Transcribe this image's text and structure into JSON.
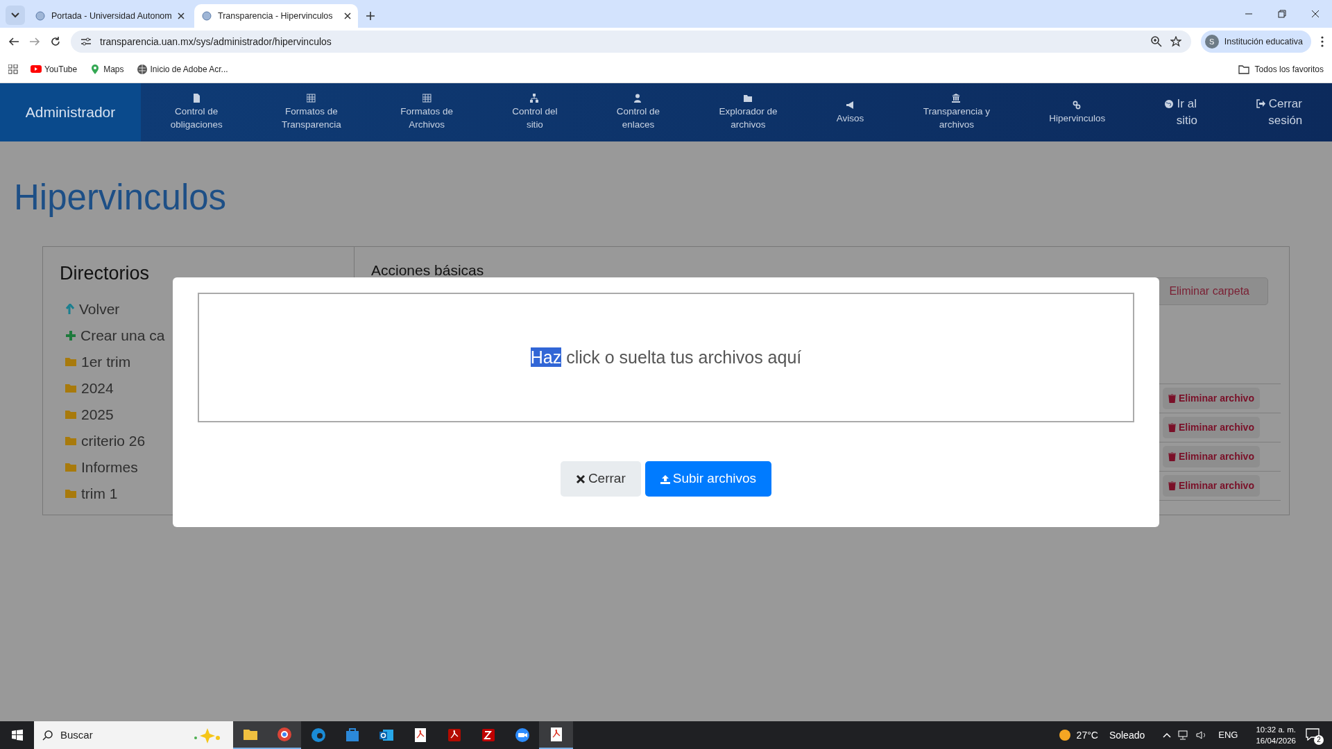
{
  "browser": {
    "tabs": [
      {
        "title": "Portada - Universidad Autonom",
        "selected": false
      },
      {
        "title": "Transparencia - Hipervinculos",
        "selected": true
      }
    ],
    "address": "transparencia.uan.mx/sys/administrador/hipervinculos",
    "profile": {
      "initial": "S",
      "name": "Institución educativa"
    },
    "bookmarks": [
      {
        "label": "YouTube"
      },
      {
        "label": "Maps"
      },
      {
        "label": "Inicio de Adobe Acr..."
      }
    ],
    "all_bookmarks": "Todos los favoritos"
  },
  "navbar": {
    "brand": "Administrador",
    "items": [
      {
        "kind": "stacked",
        "lines": [
          "Control de",
          "obligaciones"
        ]
      },
      {
        "kind": "stacked",
        "lines": [
          "Formatos de",
          "Transparencia"
        ]
      },
      {
        "kind": "stacked",
        "lines": [
          "Formatos de",
          "Archivos"
        ]
      },
      {
        "kind": "stacked",
        "lines": [
          "Control del",
          "sitio"
        ]
      },
      {
        "kind": "stacked",
        "lines": [
          "Control de",
          "enlaces"
        ]
      },
      {
        "kind": "stacked",
        "lines": [
          "Explorador de",
          "archivos"
        ]
      },
      {
        "kind": "stacked",
        "lines": [
          "Avisos"
        ]
      },
      {
        "kind": "stacked",
        "lines": [
          "Transparencia y",
          "archivos"
        ]
      },
      {
        "kind": "stacked",
        "lines": [
          "Hipervinculos"
        ]
      },
      {
        "kind": "inline",
        "lines": [
          "Ir al",
          "sitio"
        ]
      },
      {
        "kind": "inline",
        "lines": [
          "Cerrar",
          "sesión"
        ]
      }
    ]
  },
  "page": {
    "title": "Hipervinculos",
    "directories": {
      "title": "Directorios",
      "items": [
        {
          "kind": "up",
          "label": "Volver"
        },
        {
          "kind": "create",
          "label": "Crear una ca"
        },
        {
          "kind": "folder",
          "label": "1er trim"
        },
        {
          "kind": "folder",
          "label": "2024"
        },
        {
          "kind": "folder",
          "label": "2025"
        },
        {
          "kind": "folder",
          "label": "criterio 26"
        },
        {
          "kind": "folder",
          "label": "Informes"
        },
        {
          "kind": "folder",
          "label": "trim 1"
        }
      ]
    },
    "actions": {
      "title": "Acciones básicas",
      "delete_folder": "Eliminar carpeta",
      "files": [
        {
          "delete": "Eliminar archivo"
        },
        {
          "delete": "Eliminar archivo"
        },
        {
          "delete": "Eliminar archivo"
        },
        {
          "delete": "Eliminar archivo"
        }
      ]
    }
  },
  "modal": {
    "dropzone": {
      "parts": [
        {
          "text": "Haz",
          "selected": true
        },
        {
          "text": " click o suelta tus archivos aquí",
          "selected": false
        }
      ]
    },
    "buttons": [
      {
        "kind": "close",
        "label": "Cerrar"
      },
      {
        "kind": "upload",
        "label": "Subir archivos"
      }
    ]
  },
  "taskbar": {
    "search": "Buscar",
    "weather": {
      "temp": "27°C",
      "condition": "Soleado"
    },
    "language": "ENG",
    "time": "10:32 a. m.",
    "date": "16/04/2026",
    "notifications": "2"
  }
}
